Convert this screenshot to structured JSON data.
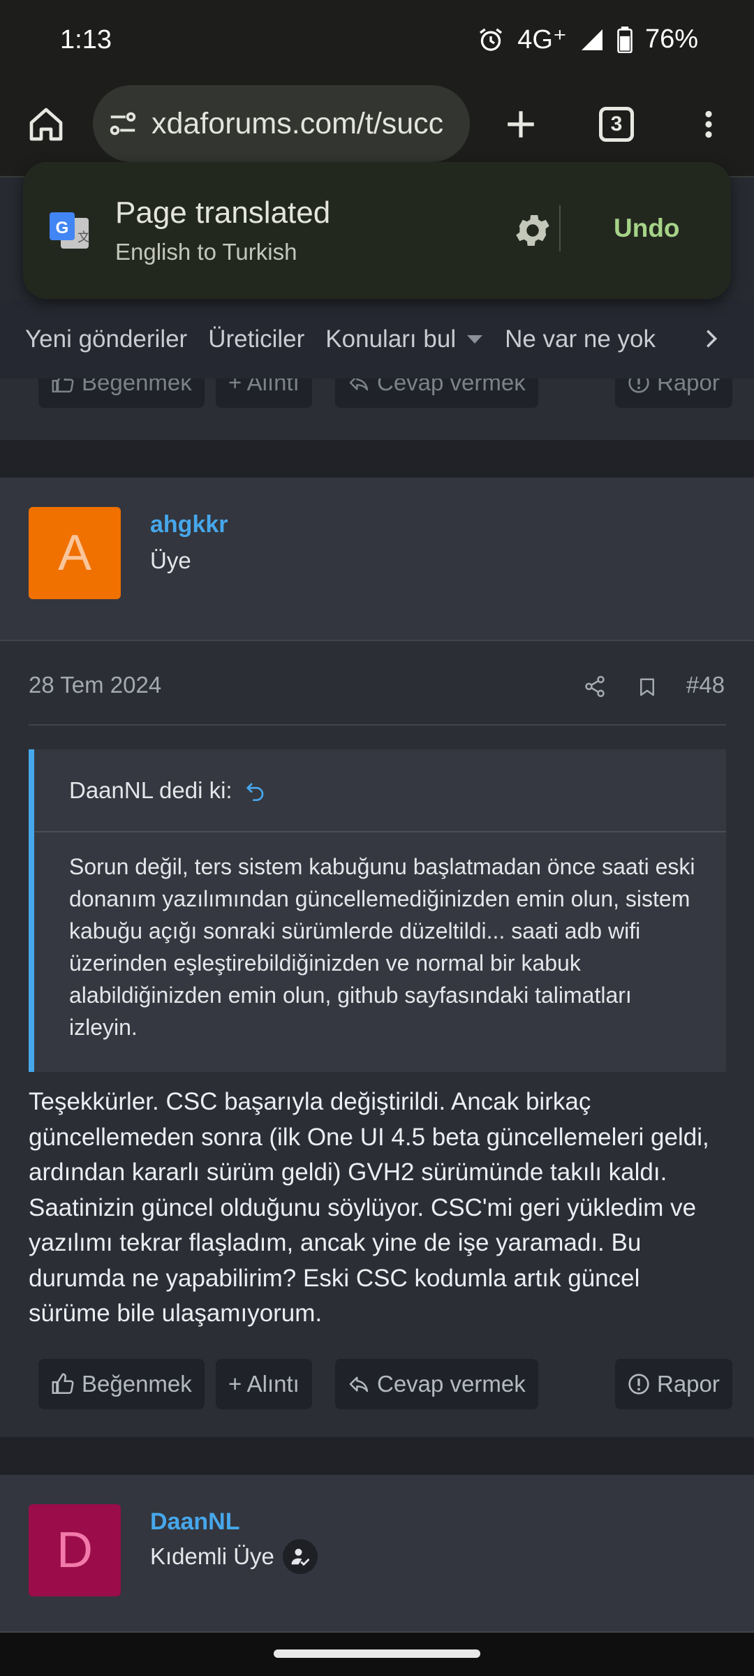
{
  "status": {
    "time": "1:13",
    "network": "4G⁺",
    "battery": "76%"
  },
  "browser": {
    "url": "xdaforums.com/t/succ",
    "tab_count": "3"
  },
  "translate_popup": {
    "title": "Page translated",
    "subtitle": "English to Turkish",
    "undo_label": "Undo"
  },
  "forum_nav": {
    "items": [
      "Yeni gönderiler",
      "Üreticiler",
      "Konuları bul",
      "Ne var ne yok"
    ]
  },
  "post_actions": {
    "like": "Beğenmek",
    "quote": "+ Alıntı",
    "reply": "Cevap vermek",
    "report": "Rapor"
  },
  "post48": {
    "author": "ahgkkr",
    "avatar_letter": "A",
    "avatar_color": "#f07000",
    "role": "Üye",
    "date": "28 Tem 2024",
    "number": "#48",
    "quote_author": "DaanNL dedi ki:",
    "quote_text": "Sorun değil, ters sistem kabuğunu başlatmadan önce saati eski donanım yazılımından güncellemediğinizden emin olun, sistem kabuğu açığı sonraki sürümlerde düzeltildi... saati adb wifi üzerinden eşleştirebildiğinizden ve normal bir kabuk alabildiğinizden emin olun, github sayfasındaki talimatları izleyin.",
    "body": "Teşekkürler. CSC başarıyla değiştirildi. Ancak birkaç güncellemeden sonra (ilk One UI 4.5 beta güncellemeleri geldi, ardından kararlı sürüm geldi) GVH2 sürümünde takılı kaldı. Saatinizin güncel olduğunu söylüyor. CSC'mi geri yükledim ve yazılımı tekrar flaşladım, ancak yine de işe yaramadı. Bu durumda ne yapabilirim? Eski CSC kodumla artık güncel sürüme bile ulaşamıyorum."
  },
  "next_post": {
    "author": "DaanNL",
    "avatar_letter": "D",
    "avatar_color": "#9a0d4a",
    "role": "Kıdemli Üye"
  }
}
